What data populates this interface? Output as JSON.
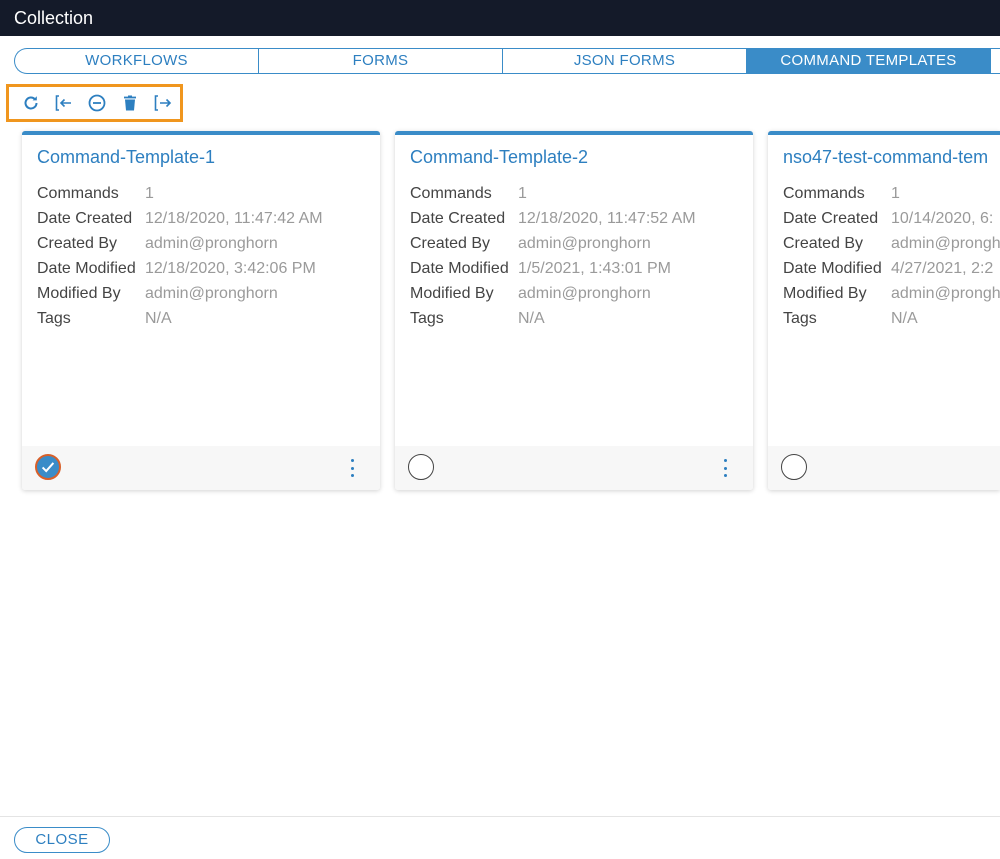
{
  "window": {
    "title": "Collection"
  },
  "tabs": [
    {
      "label": "WORKFLOWS",
      "active": false
    },
    {
      "label": "FORMS",
      "active": false
    },
    {
      "label": "JSON FORMS",
      "active": false
    },
    {
      "label": "COMMAND TEMPLATES",
      "active": true
    }
  ],
  "toolbar": {
    "icons": [
      "refresh-icon",
      "import-icon",
      "remove-icon",
      "delete-icon",
      "export-icon"
    ],
    "highlight_color": "#f0961e"
  },
  "property_labels": {
    "commands": "Commands",
    "date_created": "Date Created",
    "created_by": "Created By",
    "date_modified": "Date Modified",
    "modified_by": "Modified By",
    "tags": "Tags"
  },
  "cards": [
    {
      "title": "Command-Template-1",
      "selected": true,
      "commands": "1",
      "date_created": "12/18/2020, 11:47:42 AM",
      "created_by": "admin@pronghorn",
      "date_modified": "12/18/2020, 3:42:06 PM",
      "modified_by": "admin@pronghorn",
      "tags": "N/A"
    },
    {
      "title": "Command-Template-2",
      "selected": false,
      "commands": "1",
      "date_created": "12/18/2020, 11:47:52 AM",
      "created_by": "admin@pronghorn",
      "date_modified": "1/5/2021, 1:43:01 PM",
      "modified_by": "admin@pronghorn",
      "tags": "N/A"
    },
    {
      "title": "nso47-test-command-tem",
      "selected": false,
      "commands": "1",
      "date_created": "10/14/2020, 6:",
      "created_by": "admin@prongh",
      "date_modified": "4/27/2021, 2:2",
      "modified_by": "admin@prongh",
      "tags": "N/A"
    }
  ],
  "footer": {
    "close_label": "CLOSE"
  },
  "colors": {
    "accent": "#3a8cc8",
    "titlebar": "#141a29"
  }
}
